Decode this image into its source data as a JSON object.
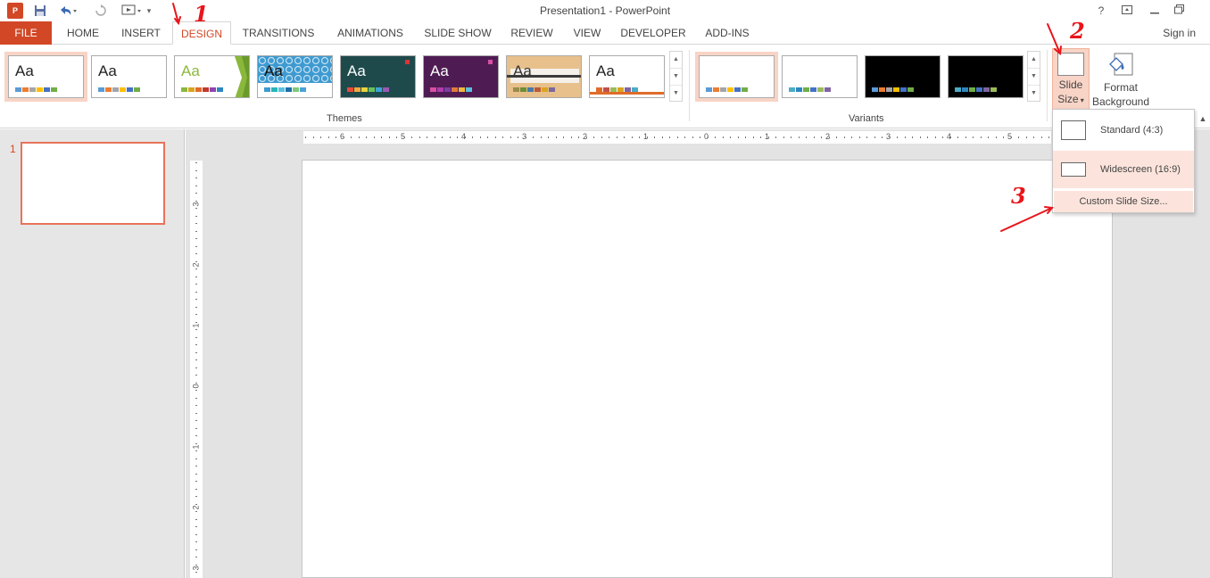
{
  "window": {
    "title": "Presentation1 - PowerPoint",
    "app_icon": "powerpoint-icon",
    "controls": [
      "help-icon",
      "ribbon-display-icon",
      "minimize-icon",
      "restore-icon"
    ]
  },
  "quick_access": [
    "save-icon",
    "undo-icon",
    "redo-icon",
    "start-from-beginning-icon",
    "customize-qat-icon"
  ],
  "tabs": [
    {
      "label": "FILE"
    },
    {
      "label": "HOME"
    },
    {
      "label": "INSERT"
    },
    {
      "label": "DESIGN",
      "active": true
    },
    {
      "label": "TRANSITIONS"
    },
    {
      "label": "ANIMATIONS"
    },
    {
      "label": "SLIDE SHOW"
    },
    {
      "label": "REVIEW"
    },
    {
      "label": "VIEW"
    },
    {
      "label": "DEVELOPER"
    },
    {
      "label": "ADD-INS"
    }
  ],
  "signin": "Sign in",
  "themes": {
    "group_label": "Themes",
    "items": [
      {
        "aa": "Aa",
        "bg": "#ffffff",
        "text": "#222222",
        "selected": true
      },
      {
        "aa": "Aa",
        "bg": "#ffffff",
        "text": "#222222"
      },
      {
        "aa": "Aa",
        "bg": "#ffffff",
        "text": "#8ab83c",
        "accent": "#8ab83c"
      },
      {
        "aa": "Aa",
        "bg": "#4aa3d6",
        "text": "#1a1a1a",
        "pattern": true
      },
      {
        "aa": "Aa",
        "bg": "#1e4a4a",
        "text": "#ffffff"
      },
      {
        "aa": "Aa",
        "bg": "#5a1e5a",
        "text": "#ffffff"
      },
      {
        "aa": "Aa",
        "bg": "#e8c38c",
        "text": "#333333"
      },
      {
        "aa": "Aa",
        "bg": "#ffffff",
        "text": "#222222",
        "accent": "#e06c2a"
      }
    ]
  },
  "variants": {
    "group_label": "Variants",
    "items": [
      {
        "bg": "#ffffff",
        "selected": true
      },
      {
        "bg": "#ffffff"
      },
      {
        "bg": "#000000"
      },
      {
        "bg": "#000000"
      }
    ]
  },
  "customize": {
    "slide_size_label_1": "Slide",
    "slide_size_label_2": "Size",
    "format_bg_label_1": "Format",
    "format_bg_label_2": "Background"
  },
  "slide_size_menu": {
    "standard": "Standard (4:3)",
    "widescreen": "Widescreen (16:9)",
    "custom": "Custom Slide Size..."
  },
  "thumbnails": [
    {
      "number": "1"
    }
  ],
  "horizontal_ruler": [
    "6",
    "5",
    "4",
    "3",
    "2",
    "1",
    "0",
    "1",
    "2",
    "3",
    "4",
    "5"
  ],
  "vertical_ruler": [
    "3",
    "2",
    "1",
    "0",
    "1",
    "2",
    "3"
  ],
  "annotations": [
    "1",
    "2",
    "3"
  ],
  "colors": {
    "accent": "#d24726",
    "selection": "#f8d4c6",
    "annotation": "#e8151b"
  }
}
